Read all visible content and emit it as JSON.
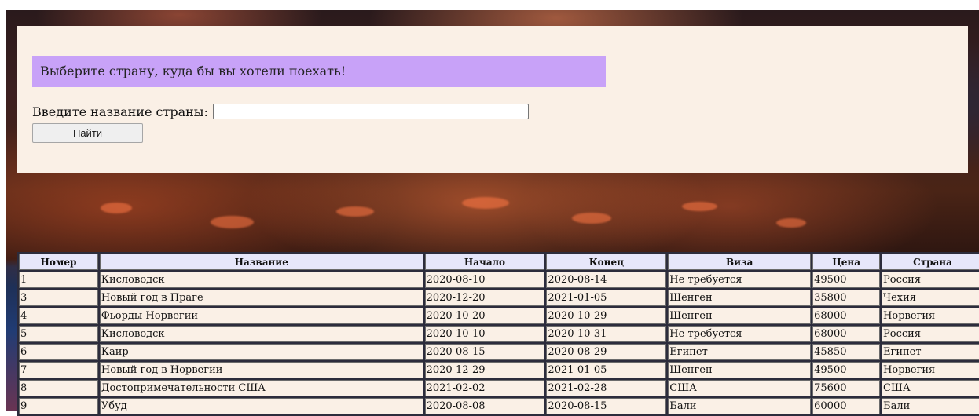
{
  "search": {
    "banner_text": "Выберите страну, куда бы вы хотели поехать!",
    "label": "Введите название страны:",
    "value": "",
    "button_label": "Найти"
  },
  "table": {
    "headers": [
      "Номер",
      "Название",
      "Начало",
      "Конец",
      "Виза",
      "Цена",
      "Страна"
    ],
    "rows": [
      [
        "1",
        "Кисловодск",
        "2020-08-10",
        "2020-08-14",
        "Не требуется",
        "49500",
        "Россия"
      ],
      [
        "3",
        "Новый год в Праге",
        "2020-12-20",
        "2021-01-05",
        "Шенген",
        "35800",
        "Чехия"
      ],
      [
        "4",
        "Фьорды Норвегии",
        "2020-10-20",
        "2020-10-29",
        "Шенген",
        "68000",
        "Норвегия"
      ],
      [
        "5",
        "Кисловодск",
        "2020-10-10",
        "2020-10-31",
        "Не требуется",
        "68000",
        "Россия"
      ],
      [
        "6",
        "Каир",
        "2020-08-15",
        "2020-08-29",
        "Египет",
        "45850",
        "Египет"
      ],
      [
        "7",
        "Новый год в Норвегии",
        "2020-12-29",
        "2021-01-05",
        "Шенген",
        "49500",
        "Норвегия"
      ],
      [
        "8",
        "Достопримечательности США",
        "2021-02-02",
        "2021-02-28",
        "США",
        "75600",
        "США"
      ],
      [
        "9",
        "Убуд",
        "2020-08-08",
        "2020-08-15",
        "Бали",
        "60000",
        "Бали"
      ]
    ]
  }
}
